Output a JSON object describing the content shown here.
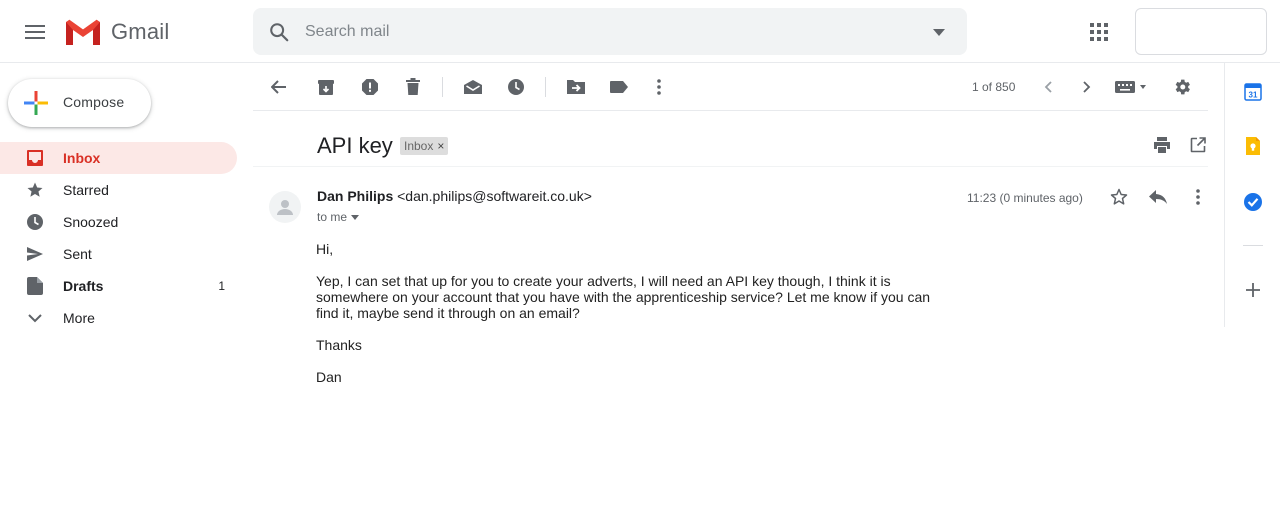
{
  "app": {
    "name": "Gmail"
  },
  "search": {
    "placeholder": "Search mail"
  },
  "compose": {
    "label": "Compose"
  },
  "sidebar": {
    "items": [
      {
        "id": "inbox",
        "label": "Inbox",
        "count": ""
      },
      {
        "id": "starred",
        "label": "Starred",
        "count": ""
      },
      {
        "id": "snoozed",
        "label": "Snoozed",
        "count": ""
      },
      {
        "id": "sent",
        "label": "Sent",
        "count": ""
      },
      {
        "id": "drafts",
        "label": "Drafts",
        "count": "1"
      },
      {
        "id": "more",
        "label": "More",
        "count": ""
      }
    ]
  },
  "toolbar": {
    "pager": "1 of 850"
  },
  "email": {
    "subject": "API key",
    "label": "Inbox",
    "sender_name": "Dan Philips",
    "sender_email": "<dan.philips@softwareit.co.uk>",
    "recipient": "to me",
    "time": "11:23 (0 minutes ago)",
    "body": [
      "Hi,",
      "Yep, I can set that up for you to create your adverts, I will need an API key though, I think it is somewhere on your account that you have with the apprenticeship service? Let me know if you can find it, maybe send it through on an email?",
      "Thanks",
      "Dan"
    ]
  },
  "colors": {
    "accent_red": "#d93025",
    "active_bg": "#fce8e6",
    "icon_gray": "#5f6368",
    "calendar_blue": "#1a73e8",
    "keep_yellow": "#fbbc04"
  },
  "icons": {
    "toolbar": [
      "back-arrow-icon",
      "archive-icon",
      "report-spam-icon",
      "delete-icon",
      "mark-unread-icon",
      "snooze-icon",
      "move-to-icon",
      "label-icon",
      "more-vert-icon"
    ],
    "right_panel": [
      "calendar-icon",
      "keep-icon",
      "tasks-icon",
      "add-icon"
    ]
  }
}
